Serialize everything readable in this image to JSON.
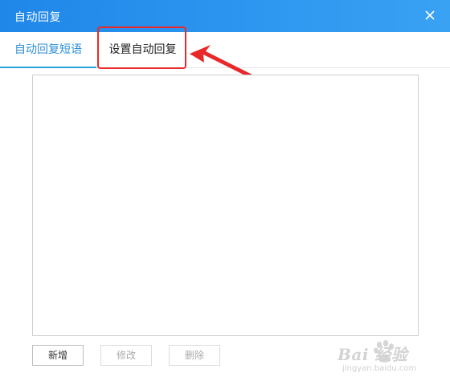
{
  "window": {
    "title": "自动回复",
    "close_icon": "close-icon"
  },
  "tabs": [
    {
      "label": "自动回复短语",
      "active": true
    },
    {
      "label": "设置自动回复",
      "active": false
    }
  ],
  "buttons": {
    "add": "新增",
    "edit": "修改",
    "delete": "删除"
  },
  "watermark": {
    "text": "Bai 经验",
    "sub": "jingyan.baidu.com"
  },
  "colors": {
    "titlebar": "#1f87e8",
    "active_tab": "#2c8fd6",
    "highlight": "#ea2a2a"
  }
}
